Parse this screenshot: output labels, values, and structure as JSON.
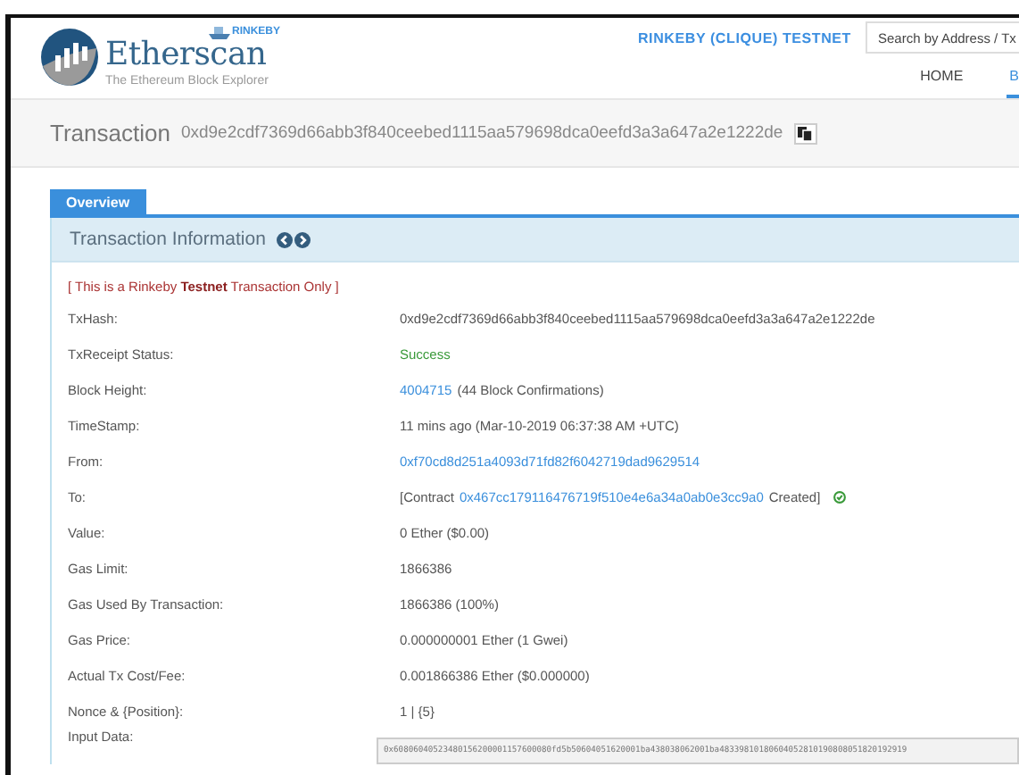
{
  "header": {
    "logo_text": "Etherscan",
    "tagline": "The Ethereum Block Explorer",
    "network_badge": "RINKEBY",
    "network_label": "RINKEBY (CLIQUE) TESTNET",
    "search": {
      "placeholder": "Search by Address / Tx"
    },
    "nav": [
      {
        "label": "HOME",
        "selected": false
      },
      {
        "label": "B",
        "selected": true
      }
    ]
  },
  "title_bar": {
    "title": "Transaction",
    "hash": "0xd9e2cdf7369d66abb3f840ceebed1115aa579698dca0eefd3a3a647a2e1222de"
  },
  "tabs": [
    {
      "label": "Overview",
      "selected": true
    }
  ],
  "panel": {
    "title": "Transaction Information",
    "notice": "[ This is a Rinkeby **Testnet** Transaction Only ]",
    "rows": [
      {
        "label": "TxHash:",
        "value": [
          {
            "kind": "plain",
            "text": "0xd9e2cdf7369d66abb3f840ceebed1115aa579698dca0eefd3a3a647a2e1222de"
          }
        ]
      },
      {
        "label": "TxReceipt Status:",
        "value": [
          {
            "kind": "success",
            "text": "Success"
          }
        ]
      },
      {
        "label": "Block Height:",
        "value": [
          {
            "kind": "link",
            "text": "4004715"
          },
          {
            "kind": "plain",
            "text": "(44 Block Confirmations)"
          }
        ]
      },
      {
        "label": "TimeStamp:",
        "value": [
          {
            "kind": "plain",
            "text": "11 mins ago (Mar-10-2019 06:37:38 AM +UTC)"
          }
        ]
      },
      {
        "label": "From:",
        "value": [
          {
            "kind": "link",
            "text": "0xf70cd8d251a4093d71fd82f6042719dad9629514"
          }
        ]
      },
      {
        "label": "To:",
        "value": [
          {
            "kind": "plain",
            "text": "[Contract"
          },
          {
            "kind": "link",
            "text": "0x467cc179116476719f510e4e6a34a0ab0e3cc9a0"
          },
          {
            "kind": "plain",
            "text": "Created]"
          },
          {
            "kind": "check"
          }
        ]
      },
      {
        "label": "Value:",
        "value": [
          {
            "kind": "plain",
            "text": "0 Ether ($0.00)"
          }
        ]
      },
      {
        "label": "Gas Limit:",
        "value": [
          {
            "kind": "plain",
            "text": "1866386"
          }
        ]
      },
      {
        "label": "Gas Used By Transaction:",
        "value": [
          {
            "kind": "plain",
            "text": "1866386 (100%)"
          }
        ]
      },
      {
        "label": "Gas Price:",
        "value": [
          {
            "kind": "plain",
            "text": "0.000000001 Ether (1 Gwei)"
          }
        ]
      },
      {
        "label": "Actual Tx Cost/Fee:",
        "value": [
          {
            "kind": "plain",
            "text": "0.001866386 Ether ($0.000000)"
          }
        ]
      },
      {
        "label": "Nonce & {Position}:",
        "value": [
          {
            "kind": "plain",
            "text": "1 | {5}"
          }
        ]
      },
      {
        "label": "Input Data:",
        "value": [
          {
            "kind": "code",
            "text": "0x60806040523480156200001157600080fd5b50604051620001ba438038062001ba48339810180604052810190808051820192919"
          }
        ]
      }
    ]
  }
}
